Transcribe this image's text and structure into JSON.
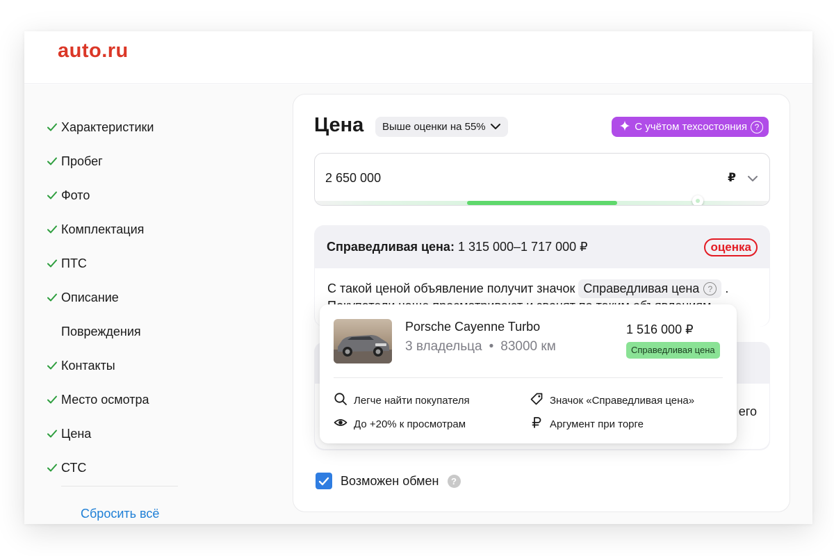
{
  "app": {
    "logo": "auto.ru"
  },
  "sidebar": {
    "items": [
      {
        "label": "Характеристики",
        "done": true
      },
      {
        "label": "Пробег",
        "done": true
      },
      {
        "label": "Фото",
        "done": true
      },
      {
        "label": "Комплектация",
        "done": true
      },
      {
        "label": "ПТС",
        "done": true
      },
      {
        "label": "Описание",
        "done": true
      },
      {
        "label": "Повреждения",
        "done": false
      },
      {
        "label": "Контакты",
        "done": true
      },
      {
        "label": "Место осмотра",
        "done": true
      },
      {
        "label": "Цена",
        "done": true
      },
      {
        "label": "СТС",
        "done": true
      }
    ],
    "reset_label": "Сбросить всё"
  },
  "price": {
    "title": "Цена",
    "estimate_pill": "Выше оценки на 55%",
    "tech_pill": "С учётом техсостояния",
    "value": "2 650 000",
    "currency": "₽"
  },
  "fair": {
    "title_bold": "Справедливая цена:",
    "range": "1 315 000–1 717 000 ₽",
    "brand": "оценка",
    "text_before": "С такой ценой объявление получит значок",
    "badge_label": "Справедливая цена",
    "text_after": ".",
    "text_line2": "Покупатели чаще просматривают и звонят по таким объявлениям"
  },
  "second": {
    "tail_text": "его"
  },
  "exchange": {
    "label": "Возможен обмен",
    "checked": true
  },
  "popup": {
    "car_name": "Porsche Cayenne Turbo",
    "owners": "3 владельца",
    "separator": "•",
    "mileage": "83000 км",
    "price": "1 516 000 ₽",
    "tag": "Справедливая цена",
    "benefits": [
      {
        "icon": "search-icon",
        "label": "Легче найти покупателя"
      },
      {
        "icon": "tag-icon",
        "label": "Значок «Справедливая цена»"
      },
      {
        "icon": "eye-icon",
        "label": "До +20% к просмотрам"
      },
      {
        "icon": "ruble-icon",
        "label": "Аргумент при торге"
      }
    ]
  },
  "colors": {
    "brand": "#db3727",
    "accent_purple": "#b04ce8",
    "link": "#1e7fd6",
    "check": "#2e9e3e",
    "fair_green": "#8ae295",
    "range_fill": "#5fd86c",
    "checkbox": "#2f7de1"
  }
}
